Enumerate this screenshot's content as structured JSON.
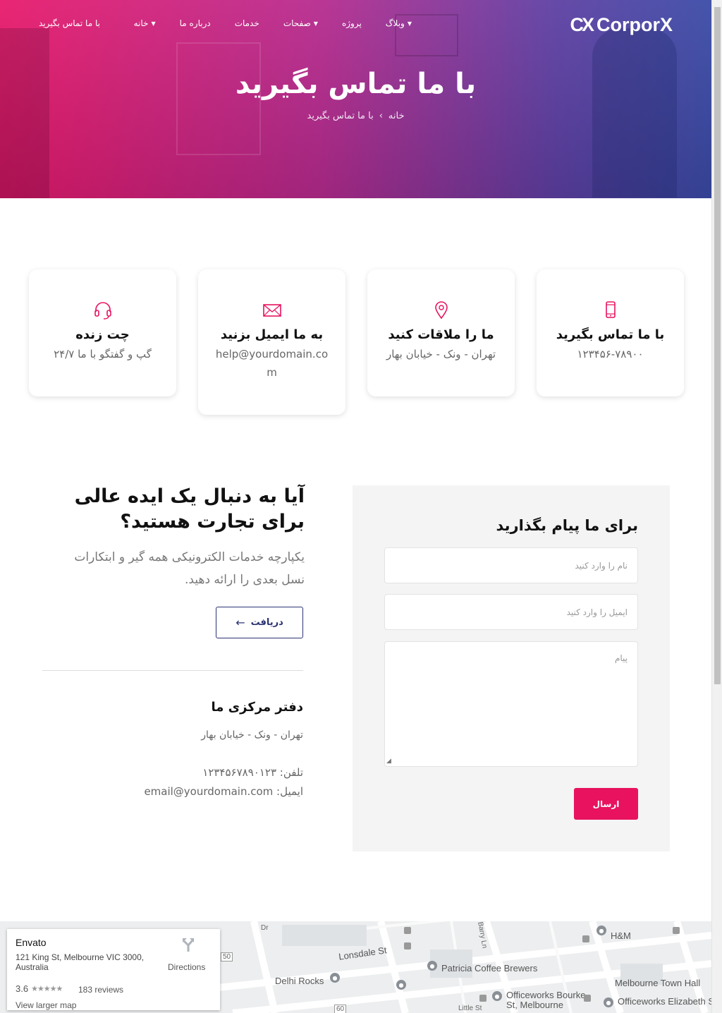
{
  "brand": {
    "logo_mark": "CX",
    "logo_text": "CorporX"
  },
  "nav": {
    "items": [
      {
        "label": "خانه",
        "dropdown": true
      },
      {
        "label": "درباره ما",
        "dropdown": false
      },
      {
        "label": "خدمات",
        "dropdown": false
      },
      {
        "label": "صفحات",
        "dropdown": true
      },
      {
        "label": "پروژه",
        "dropdown": false
      },
      {
        "label": "وبلاگ",
        "dropdown": true
      }
    ],
    "contact": "با ما تماس بگیرید"
  },
  "hero": {
    "title": "با ما تماس بگیرید",
    "breadcrumb_home": "خانه",
    "breadcrumb_sep": "›",
    "breadcrumb_current": "با ما تماس بگیرید"
  },
  "cards": [
    {
      "icon": "phone-icon",
      "title": "با ما تماس بگیرید",
      "text": "۱۲۳۴۵۶-۷۸۹۰۰"
    },
    {
      "icon": "location-pin-icon",
      "title": "ما را ملاقات کنید",
      "text": "تهران - ونک - خیابان بهار"
    },
    {
      "icon": "envelope-icon",
      "title": "به ما ایمیل بزنید",
      "text": "help@yourdomain.com"
    },
    {
      "icon": "headset-icon",
      "title": "چت زنده",
      "text": "گپ و گفتگو با ما ۲۴/۷"
    }
  ],
  "accent": "#e8125f",
  "idea": {
    "title": "آیا به دنبال یک ایده عالی برای تجارت هستید؟",
    "text": "یکپارچه خدمات الکترونیکی همه گیر و ابتکارات نسل بعدی را ارائه دهید.",
    "button": "دریافت"
  },
  "office": {
    "title": "دفتر مرکزی ما",
    "address": "تهران - ونک - خیابان بهار",
    "phone_label": "تلفن:",
    "phone": "۱۲۳۴۵۶۷۸۹۰۱۲۳",
    "email_label": "ایمیل:",
    "email": "email@yourdomain.com"
  },
  "form": {
    "title": "برای ما پیام بگذارید",
    "name_placeholder": "نام را وارد کنید",
    "email_placeholder": "ایمیل را وارد کنید",
    "message_placeholder": "پیام",
    "submit": "ارسال"
  },
  "map": {
    "place_name": "Envato",
    "address": "121 King St, Melbourne VIC 3000, Australia",
    "rating": "3.6",
    "stars": "★★★★★",
    "reviews": "183 reviews",
    "larger_map": "View larger map",
    "directions": "Directions",
    "labels": {
      "lonsdale": "Lonsdale St",
      "barry": "Barry Ln",
      "h_and_m": "H&M",
      "patricia": "Patricia Coffee Brewers",
      "delhi": "Delhi Rocks",
      "officeworks1": "Officeworks Bourke St, Melbourne",
      "town_hall": "Melbourne Town Hall",
      "officeworks2": "Officeworks Elizabeth St",
      "little_st": "Little St",
      "road50": "50",
      "road60": "60",
      "dr": "Dr"
    }
  }
}
